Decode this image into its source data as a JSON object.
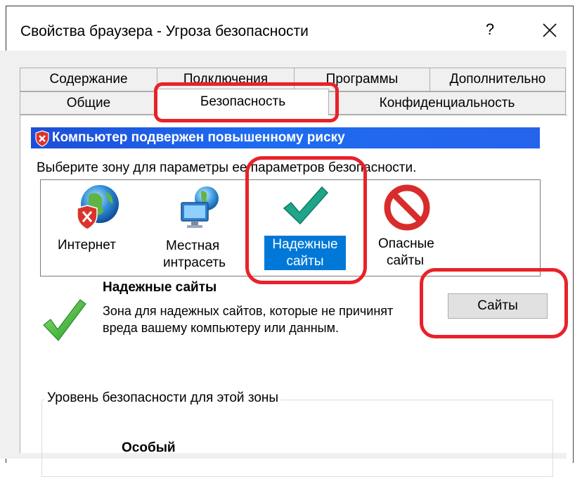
{
  "window": {
    "title": "Свойства браузера - Угроза безопасности",
    "help_label": "?"
  },
  "tabs": {
    "row1": [
      "Содержание",
      "Подключения",
      "Программы",
      "Дополнительно"
    ],
    "row2": [
      "Общие",
      "Безопасность",
      "Конфиденциальность"
    ],
    "selected": "Безопасность"
  },
  "security": {
    "risk_banner": "Компьютер подвержен повышенному риску",
    "zone_prompt": "Выберите зону для параметры ее параметров безопасности.",
    "zones": [
      {
        "label_line1": "Интернет",
        "label_line2": "",
        "icon": "globe-shield-icon"
      },
      {
        "label_line1": "Местная",
        "label_line2": "интрасеть",
        "icon": "network-globe-icon"
      },
      {
        "label_line1": "Надежные",
        "label_line2": "сайты",
        "icon": "checkmark-icon",
        "selected": true
      },
      {
        "label_line1": "Опасные",
        "label_line2": "сайты",
        "icon": "no-entry-icon"
      }
    ],
    "selected_zone": {
      "name": "Надежные сайты",
      "description": "Зона для надежных сайтов, которые не причинят вреда вашему компьютеру или данным."
    },
    "sites_button_label": "Сайты",
    "level_group_label": "Уровень безопасности для этой зоны",
    "level_value": "Особый"
  },
  "colors": {
    "banner_blue": "#1e5fe6",
    "selection_blue": "#0078d7",
    "annotation_red": "#e8222a"
  }
}
